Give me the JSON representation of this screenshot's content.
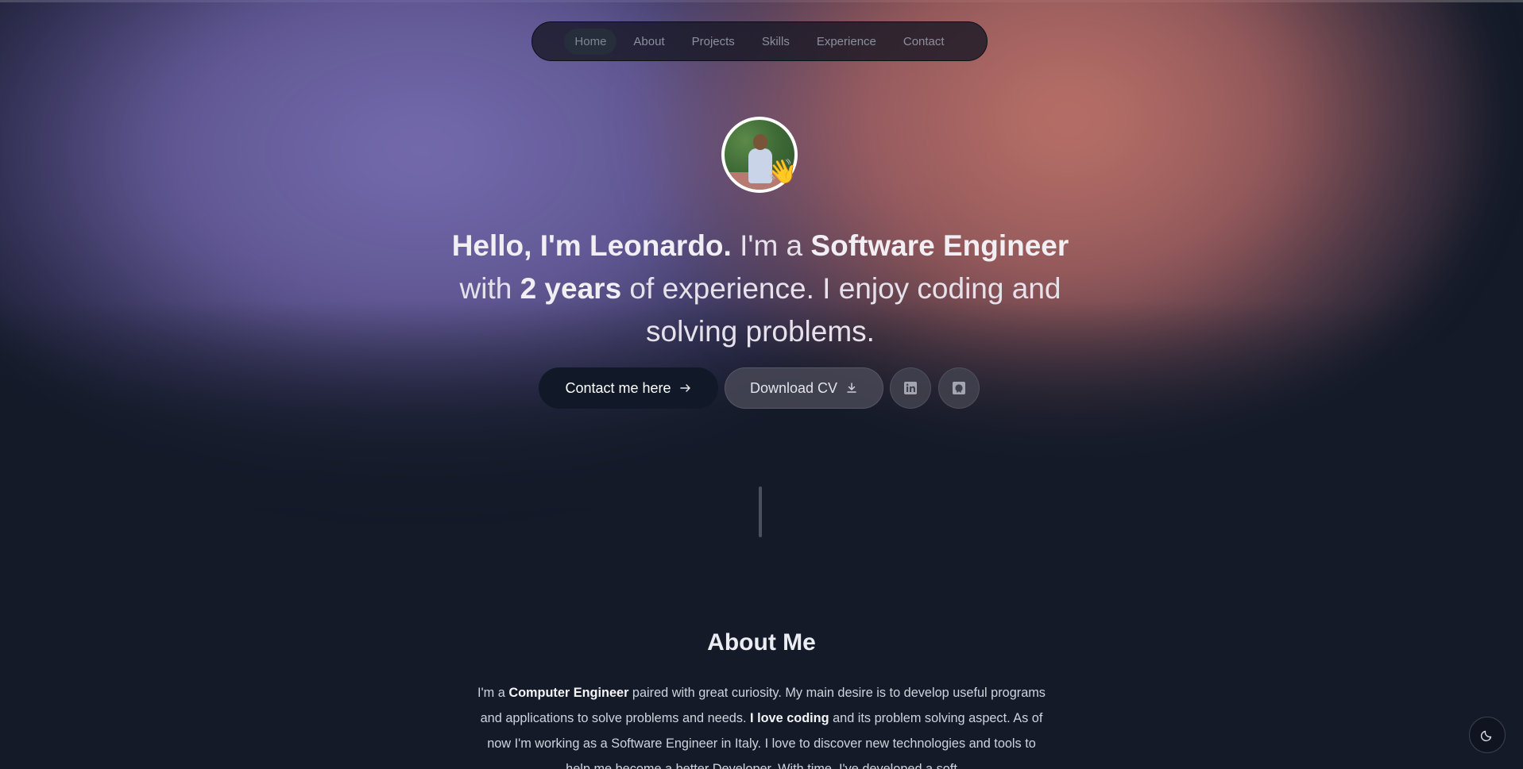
{
  "nav": {
    "items": [
      {
        "label": "Home",
        "active": true
      },
      {
        "label": "About",
        "active": false
      },
      {
        "label": "Projects",
        "active": false
      },
      {
        "label": "Skills",
        "active": false
      },
      {
        "label": "Experience",
        "active": false
      },
      {
        "label": "Contact",
        "active": false
      }
    ]
  },
  "hero": {
    "wave_emoji": "👋",
    "headline": {
      "part1_bold": "Hello, I'm Leonardo.",
      "part2": " I'm a ",
      "part3_bold": "Software Engineer",
      "part4": " with ",
      "part5_bold": "2 years",
      "part6": " of experience. I enjoy coding and solving problems."
    },
    "contact_button": "Contact me here",
    "cv_button": "Download CV",
    "linkedin_icon": "linkedin-icon",
    "github_icon": "github-icon"
  },
  "about": {
    "title": "About Me",
    "p1": "I'm a ",
    "p2_bold": "Computer Engineer",
    "p3": " paired with great curiosity. My main desire is to develop useful programs and applications to solve problems and needs. ",
    "p4_bold": "I love coding",
    "p5": " and its problem solving aspect. As of now I'm working as a Software Engineer in Italy. I love to discover new technologies and tools to help me become a better Developer. With time, I've developed a soft"
  },
  "theme_toggle": {
    "icon": "moon-icon"
  },
  "colors": {
    "background": "#141a28",
    "glow_purple": "#7a70b6",
    "glow_pink": "#c4766c",
    "contact_button_bg": "#111827"
  }
}
